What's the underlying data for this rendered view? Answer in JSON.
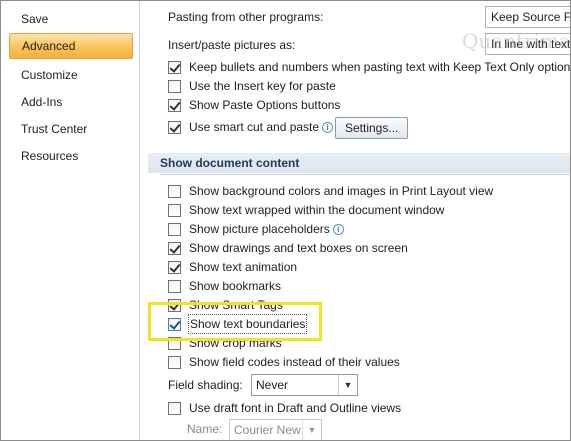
{
  "sidebar": {
    "items": [
      {
        "label": "Save",
        "active": false
      },
      {
        "label": "Advanced",
        "active": true
      },
      {
        "label": "Customize",
        "active": false
      },
      {
        "label": "Add-Ins",
        "active": false
      },
      {
        "label": "Trust Center",
        "active": false
      },
      {
        "label": "Resources",
        "active": false
      }
    ]
  },
  "cut_copy_paste": {
    "pasting_from_other_programs_label": "Pasting from other programs:",
    "pasting_from_other_programs_value": "Keep Source Fo",
    "insert_paste_pictures_label": "Insert/paste pictures as:",
    "insert_paste_pictures_value": "In line with text",
    "options": [
      {
        "label": "Keep bullets and numbers when pasting text with Keep Text Only option",
        "checked": true
      },
      {
        "label": "Use the Insert key for paste",
        "checked": false
      },
      {
        "label": "Show Paste Options buttons",
        "checked": true
      },
      {
        "label": "Use smart cut and paste",
        "checked": true,
        "info": true
      }
    ],
    "settings_button": "Settings..."
  },
  "show_document_content": {
    "header": "Show document content",
    "options": [
      {
        "label": "Show background colors and images in Print Layout view",
        "checked": false
      },
      {
        "label": "Show text wrapped within the document window",
        "checked": false
      },
      {
        "label": "Show picture placeholders",
        "checked": false,
        "info": true
      },
      {
        "label": "Show drawings and text boxes on screen",
        "checked": true
      },
      {
        "label": "Show text animation",
        "checked": true
      },
      {
        "label": "Show bookmarks",
        "checked": false
      },
      {
        "label": "Show Smart Tags",
        "checked": true
      },
      {
        "label": "Show text boundaries",
        "checked": true,
        "highlighted": true
      },
      {
        "label": "Show crop marks",
        "checked": false
      },
      {
        "label": "Show field codes instead of their values",
        "checked": false
      }
    ],
    "field_shading_label": "Field shading:",
    "field_shading_value": "Never",
    "draft_font_label": "Use draft font in Draft and Outline views",
    "draft_font_checked": false,
    "name_label": "Name:",
    "name_value": "Courier New"
  },
  "watermark": "Quantrimang",
  "colors": {
    "active_nav": "#f8c25c",
    "highlight_box": "#f3e21f",
    "section_header_bg": "#e3e9f1"
  }
}
